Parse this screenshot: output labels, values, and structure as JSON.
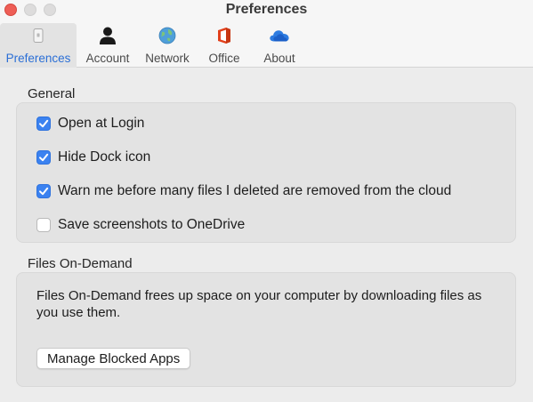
{
  "window": {
    "title": "Preferences"
  },
  "tabs": [
    {
      "label": "Preferences",
      "icon": "phone-icon",
      "active": true
    },
    {
      "label": "Account",
      "icon": "person-icon"
    },
    {
      "label": "Network",
      "icon": "globe-icon"
    },
    {
      "label": "Office",
      "icon": "office-logo-icon"
    },
    {
      "label": "About",
      "icon": "onedrive-cloud-icon"
    }
  ],
  "general": {
    "title": "General",
    "options": [
      {
        "label": "Open at Login",
        "checked": true
      },
      {
        "label": "Hide Dock icon",
        "checked": true
      },
      {
        "label": "Warn me before many files I deleted are removed from the cloud",
        "checked": true
      },
      {
        "label": "Save screenshots to OneDrive",
        "checked": false
      }
    ]
  },
  "files_on_demand": {
    "title": "Files On-Demand",
    "description": "Files On-Demand frees up space on your computer by downloading files as you use them.",
    "button_label": "Manage Blocked Apps"
  },
  "colors": {
    "accent": "#3b82f0",
    "active_tab_text": "#2b6fd6",
    "close_button": "#ee5e56"
  }
}
